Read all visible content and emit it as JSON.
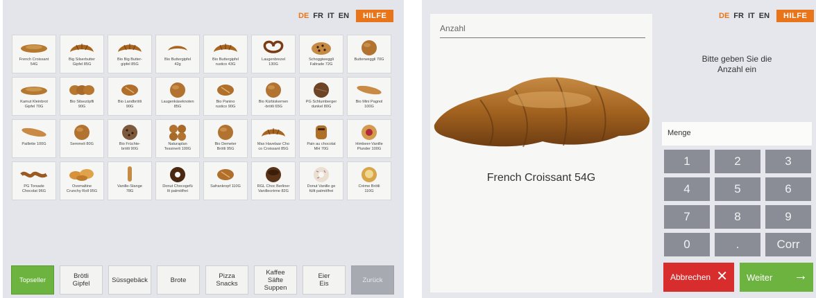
{
  "languages": [
    "DE",
    "FR",
    "IT",
    "EN"
  ],
  "active_language": "DE",
  "help_label": "HILFE",
  "products": [
    {
      "name": "French Croissant\n54G",
      "icon": "croissant-flat-icon"
    },
    {
      "name": "Big Silserbutter\nGipfel 85G",
      "icon": "croissant-icon"
    },
    {
      "name": "Bio Big Butter-\ngipfel 85G",
      "icon": "croissant-icon"
    },
    {
      "name": "Bio Buttergipfel\n42g",
      "icon": "croissant-small-icon"
    },
    {
      "name": "Bio Buttergipfel\nrustico 43G",
      "icon": "croissant-icon"
    },
    {
      "name": "Laugenbrezel\n130G",
      "icon": "pretzel-icon"
    },
    {
      "name": "Schoggiweggli\nFaltrade 72G",
      "icon": "chocolate-bun-icon"
    },
    {
      "name": "Butterweggli 70G",
      "icon": "round-bun-icon"
    },
    {
      "name": "Kamut Kleinbrot\nGipfel 70G",
      "icon": "croissant-flat-icon"
    },
    {
      "name": "Bio Silsezöpfli\n90G",
      "icon": "braid-icon"
    },
    {
      "name": "Bio Landbrötli\n90G",
      "icon": "roll-icon"
    },
    {
      "name": "Laugenkäseknoten\n85G",
      "icon": "round-bun-icon"
    },
    {
      "name": "Bio Panino\nrustico 90G",
      "icon": "roll-icon"
    },
    {
      "name": "Bio Kürbiskernen\n-brötli 65G",
      "icon": "round-bun-icon"
    },
    {
      "name": "PG Schlumberger\ndunkel 80G",
      "icon": "dark-roll-icon"
    },
    {
      "name": "Bio Mini Pagnol\n100G",
      "icon": "baguette-icon"
    },
    {
      "name": "Paillette 100G",
      "icon": "baguette-icon"
    },
    {
      "name": "Semmeli 80G",
      "icon": "round-bun-icon"
    },
    {
      "name": "Bio Früchte-\nbrötli 90G",
      "icon": "fruit-bun-icon"
    },
    {
      "name": "Naturaplan\nTessinerli 100G",
      "icon": "tessiner-icon"
    },
    {
      "name": "Bio Demeter\nBrötli 95G",
      "icon": "round-bun-icon"
    },
    {
      "name": "Max Havelaar Cho\nco Croissant 85G",
      "icon": "croissant-icon"
    },
    {
      "name": "Pain au chocolat\nMH 70G",
      "icon": "pain-chocolat-icon"
    },
    {
      "name": "Himbeer-Vanille\nPlunder 100G",
      "icon": "pastry-icon"
    },
    {
      "name": "PG Torsade\nChocolat 96G",
      "icon": "torsade-icon"
    },
    {
      "name": "Ovomaltine\nCrunchy Roll 95G",
      "icon": "rolls-tray-icon"
    },
    {
      "name": "Vanille-Stange\n78G",
      "icon": "stick-icon"
    },
    {
      "name": "Donut Chocogefü\nllt palmölfrei",
      "icon": "donut-choc-icon"
    },
    {
      "name": "Safrankropf 110G",
      "icon": "roll-icon"
    },
    {
      "name": "RGL Choc Berliner\nVanillecrème 82G",
      "icon": "berliner-icon"
    },
    {
      "name": "Donut Vanille ge\nfüllt palmölfrei",
      "icon": "donut-vanilla-icon"
    },
    {
      "name": "Crème Brötli\n110G",
      "icon": "cream-bun-icon"
    }
  ],
  "categories": [
    {
      "label": "Topseller",
      "state": "active"
    },
    {
      "label": "Brötli\nGipfel",
      "state": "normal"
    },
    {
      "label": "Süssgebäck",
      "state": "normal"
    },
    {
      "label": "Brote",
      "state": "normal"
    },
    {
      "label": "Pizza\nSnacks",
      "state": "normal"
    },
    {
      "label": "Kaffee\nSäfte\nSuppen",
      "state": "normal"
    },
    {
      "label": "Eier\nEis",
      "state": "normal"
    },
    {
      "label": "Zurück",
      "state": "disabled"
    }
  ],
  "detail": {
    "quantity_label": "Anzahl",
    "product_name": "French Croissant 54G",
    "prompt": "Bitte geben Sie die\nAnzahl ein",
    "amount_field_label": "Menge"
  },
  "keypad": [
    "1",
    "2",
    "3",
    "4",
    "5",
    "6",
    "7",
    "8",
    "9",
    "0",
    ".",
    "Corr"
  ],
  "cancel_label": "Abbrechen",
  "next_label": "Weiter",
  "colors": {
    "accent_orange": "#e8751a",
    "green": "#6cb33f",
    "red": "#d72d2d",
    "key_grey": "#8a8c96"
  }
}
